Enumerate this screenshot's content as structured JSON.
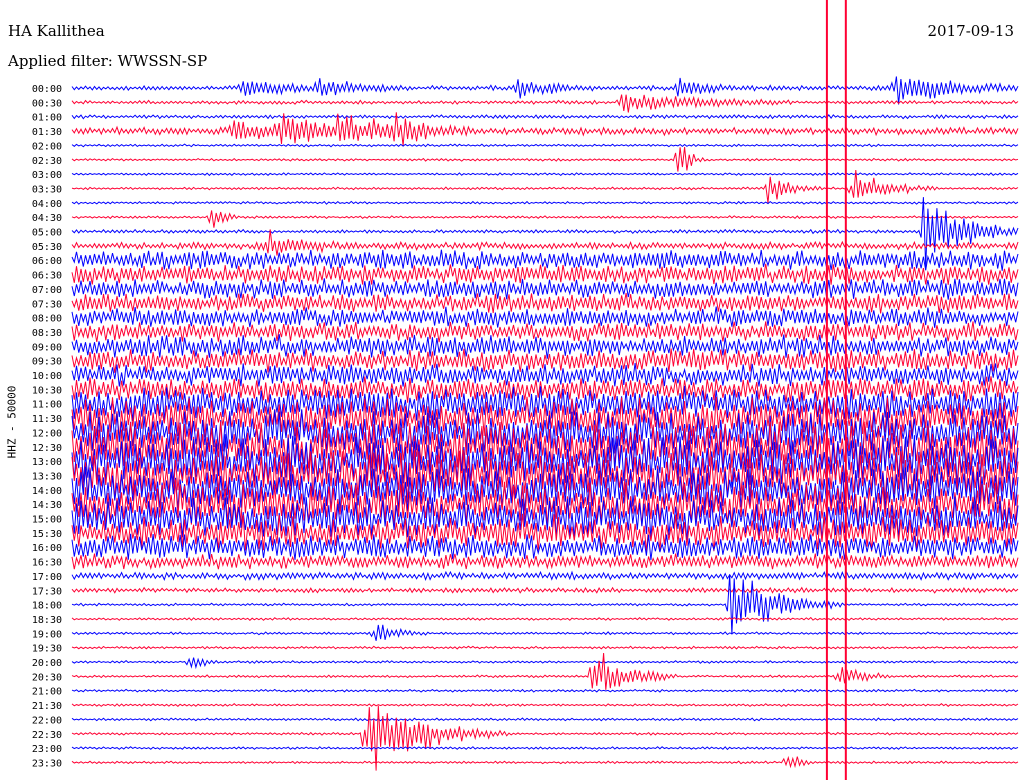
{
  "header": {
    "station": "HA Kallithea",
    "date": "2017-09-13",
    "filter": "Applied filter: WWSSN-SP"
  },
  "chart_data": {
    "type": "line",
    "title": "HA Kallithea",
    "subtitle": "Applied filter: WWSSN-SP",
    "date": "2017-09-13",
    "ylabel": "HHZ - 50000",
    "xlabel": "",
    "row_labels": [
      "00:00",
      "00:30",
      "01:00",
      "01:30",
      "02:00",
      "02:30",
      "03:00",
      "03:30",
      "04:00",
      "04:30",
      "05:00",
      "05:30",
      "06:00",
      "06:30",
      "07:00",
      "07:30",
      "08:00",
      "08:30",
      "09:00",
      "09:30",
      "10:00",
      "10:30",
      "11:00",
      "11:30",
      "12:00",
      "12:30",
      "13:00",
      "13:30",
      "14:00",
      "14:30",
      "15:00",
      "15:30",
      "16:00",
      "16:30",
      "17:00",
      "17:30",
      "18:00",
      "18:30",
      "19:00",
      "19:30",
      "20:00",
      "20:30",
      "21:00",
      "21:30",
      "22:00",
      "22:30",
      "23:00",
      "23:30"
    ],
    "trace_colors": [
      "#0000ff",
      "#ff0033"
    ],
    "noise_level": [
      2,
      1.5,
      1.5,
      3,
      1,
      1,
      1,
      1,
      1,
      1,
      1.5,
      3,
      8,
      8,
      8,
      8,
      8,
      8,
      9,
      9,
      9,
      10,
      14,
      16,
      18,
      20,
      20,
      20,
      18,
      18,
      16,
      14,
      10,
      6,
      3,
      2,
      1,
      1,
      1,
      1,
      1,
      1,
      1,
      1,
      1,
      1,
      1,
      1
    ],
    "events": [
      {
        "row": 0,
        "pos": 0.18,
        "amp": 8,
        "dur": 0.04
      },
      {
        "row": 0,
        "pos": 0.26,
        "amp": 10,
        "dur": 0.03
      },
      {
        "row": 0,
        "pos": 0.47,
        "amp": 9,
        "dur": 0.03
      },
      {
        "row": 0,
        "pos": 0.64,
        "amp": 12,
        "dur": 0.02
      },
      {
        "row": 0,
        "pos": 0.87,
        "amp": 16,
        "dur": 0.05
      },
      {
        "row": 1,
        "pos": 0.58,
        "amp": 10,
        "dur": 0.06
      },
      {
        "row": 3,
        "pos": 0.17,
        "amp": 12,
        "dur": 0.03
      },
      {
        "row": 3,
        "pos": 0.22,
        "amp": 14,
        "dur": 0.05
      },
      {
        "row": 3,
        "pos": 0.28,
        "amp": 12,
        "dur": 0.04
      },
      {
        "row": 3,
        "pos": 0.34,
        "amp": 10,
        "dur": 0.03
      },
      {
        "row": 5,
        "pos": 0.64,
        "amp": 22,
        "dur": 0.01
      },
      {
        "row": 7,
        "pos": 0.735,
        "amp": 14,
        "dur": 0.02
      },
      {
        "row": 7,
        "pos": 0.825,
        "amp": 16,
        "dur": 0.03
      },
      {
        "row": 9,
        "pos": 0.148,
        "amp": 16,
        "dur": 0.01
      },
      {
        "row": 10,
        "pos": 0.9,
        "amp": 30,
        "dur": 0.04
      },
      {
        "row": 11,
        "pos": 0.205,
        "amp": 10,
        "dur": 0.03
      },
      {
        "row": 36,
        "pos": 0.695,
        "amp": 34,
        "dur": 0.04
      },
      {
        "row": 38,
        "pos": 0.32,
        "amp": 10,
        "dur": 0.02
      },
      {
        "row": 40,
        "pos": 0.125,
        "amp": 12,
        "dur": 0.01
      },
      {
        "row": 41,
        "pos": 0.55,
        "amp": 24,
        "dur": 0.03
      },
      {
        "row": 41,
        "pos": 0.81,
        "amp": 12,
        "dur": 0.02
      },
      {
        "row": 45,
        "pos": 0.31,
        "amp": 40,
        "dur": 0.05
      },
      {
        "row": 47,
        "pos": 0.755,
        "amp": 14,
        "dur": 0.01
      }
    ],
    "spikes": [
      {
        "pos": 0.798,
        "color": "#ff0033"
      },
      {
        "pos": 0.818,
        "color": "#ff0033"
      }
    ]
  }
}
